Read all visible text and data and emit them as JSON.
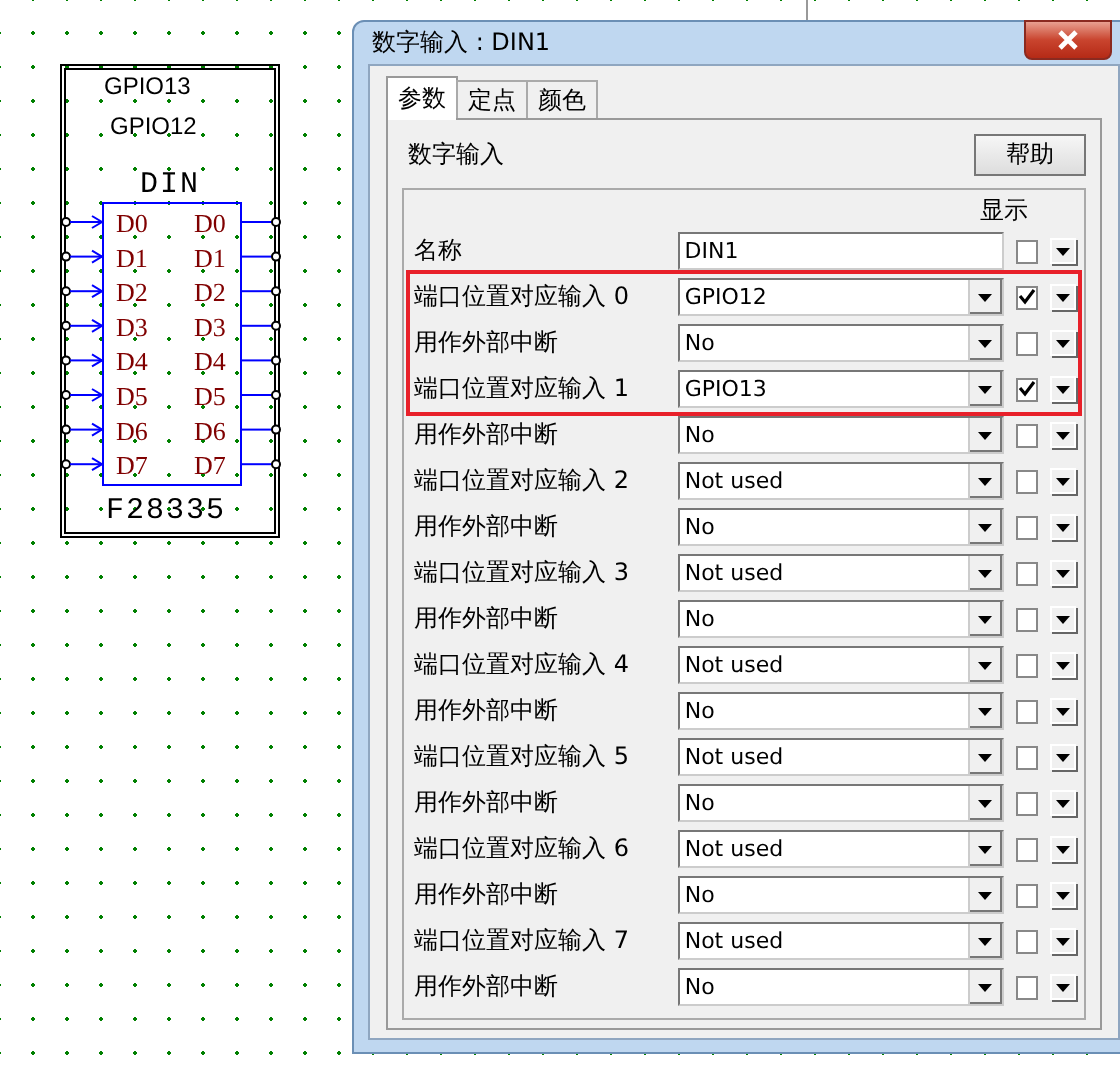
{
  "schematic": {
    "labels": [
      "GPIO13",
      "GPIO12"
    ],
    "title": "DIN",
    "inputs": [
      "D0",
      "D1",
      "D2",
      "D3",
      "D4",
      "D5",
      "D6",
      "D7"
    ],
    "outputs": [
      "D0",
      "D1",
      "D2",
      "D3",
      "D4",
      "D5",
      "D6",
      "D7"
    ],
    "chip": "F28335"
  },
  "dialog": {
    "title": "数字输入 : DIN1",
    "tabs": [
      {
        "label": "参数",
        "selected": true
      },
      {
        "label": "定点",
        "selected": false
      },
      {
        "label": "颜色",
        "selected": false
      }
    ],
    "section": "数字输入",
    "help": "帮助",
    "column_header": "显示",
    "name_row": {
      "label": "名称",
      "value": "DIN1",
      "shown": false
    },
    "rows": [
      {
        "label": "端口位置对应输入 0",
        "value": "GPIO12",
        "shown": true,
        "highlighted": true
      },
      {
        "label": "用作外部中断",
        "value": "No",
        "shown": false,
        "highlighted": true
      },
      {
        "label": "端口位置对应输入 1",
        "value": "GPIO13",
        "shown": true,
        "highlighted": true
      },
      {
        "label": "用作外部中断",
        "value": "No",
        "shown": false,
        "highlighted": false
      },
      {
        "label": "端口位置对应输入 2",
        "value": "Not used",
        "shown": false,
        "highlighted": false
      },
      {
        "label": "用作外部中断",
        "value": "No",
        "shown": false,
        "highlighted": false
      },
      {
        "label": "端口位置对应输入 3",
        "value": "Not used",
        "shown": false,
        "highlighted": false
      },
      {
        "label": "用作外部中断",
        "value": "No",
        "shown": false,
        "highlighted": false
      },
      {
        "label": "端口位置对应输入 4",
        "value": "Not used",
        "shown": false,
        "highlighted": false
      },
      {
        "label": "用作外部中断",
        "value": "No",
        "shown": false,
        "highlighted": false
      },
      {
        "label": "端口位置对应输入 5",
        "value": "Not used",
        "shown": false,
        "highlighted": false
      },
      {
        "label": "用作外部中断",
        "value": "No",
        "shown": false,
        "highlighted": false
      },
      {
        "label": "端口位置对应输入 6",
        "value": "Not used",
        "shown": false,
        "highlighted": false
      },
      {
        "label": "用作外部中断",
        "value": "No",
        "shown": false,
        "highlighted": false
      },
      {
        "label": "端口位置对应输入 7",
        "value": "Not used",
        "shown": false,
        "highlighted": false
      },
      {
        "label": "用作外部中断",
        "value": "No",
        "shown": false,
        "highlighted": false
      }
    ]
  }
}
